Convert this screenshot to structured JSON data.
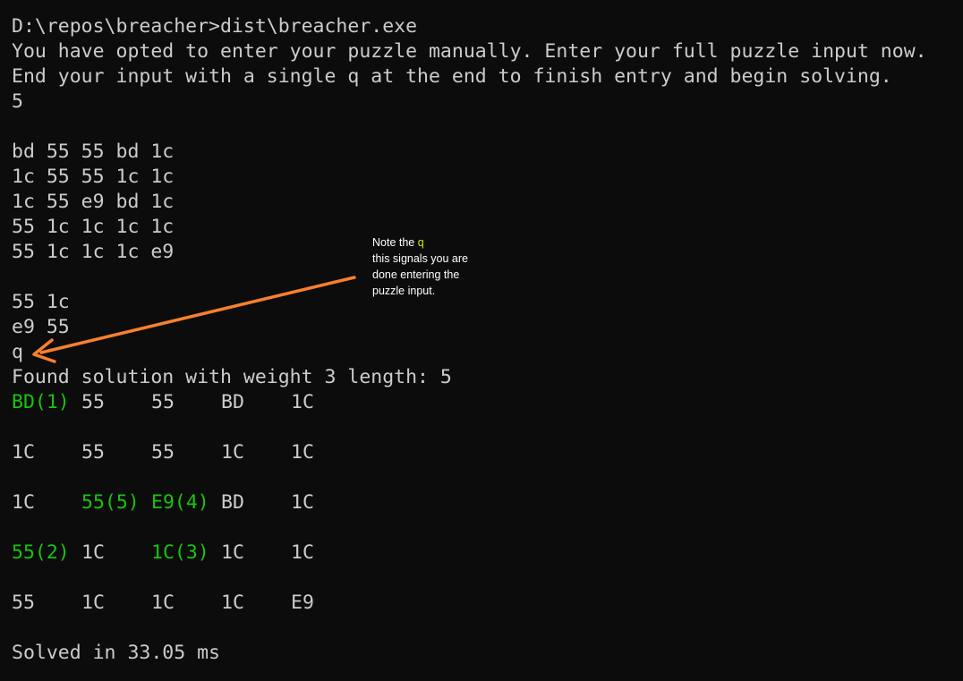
{
  "terminal": {
    "lines": [
      "D:\\repos\\breacher>dist\\breacher.exe",
      "You have opted to enter your puzzle manually. Enter your full puzzle input now.",
      "End your input with a single q at the end to finish entry and begin solving.",
      "5",
      "",
      "bd 55 55 bd 1c",
      "1c 55 55 1c 1c",
      "1c 55 e9 bd 1c",
      "55 1c 1c 1c 1c",
      "55 1c 1c 1c e9",
      "",
      "55 1c",
      "e9 55",
      "q",
      "Found solution with weight 3 length: 5"
    ],
    "solution_grid": [
      [
        {
          "t": "BD(1)",
          "hl": true
        },
        {
          "t": "55",
          "hl": false
        },
        {
          "t": "55",
          "hl": false
        },
        {
          "t": "BD",
          "hl": false
        },
        {
          "t": "1C",
          "hl": false
        }
      ],
      [
        {
          "t": "1C",
          "hl": false
        },
        {
          "t": "55",
          "hl": false
        },
        {
          "t": "55",
          "hl": false
        },
        {
          "t": "1C",
          "hl": false
        },
        {
          "t": "1C",
          "hl": false
        }
      ],
      [
        {
          "t": "1C",
          "hl": false
        },
        {
          "t": "55(5)",
          "hl": true
        },
        {
          "t": "E9(4)",
          "hl": true
        },
        {
          "t": "BD",
          "hl": false
        },
        {
          "t": "1C",
          "hl": false
        }
      ],
      [
        {
          "t": "55(2)",
          "hl": true
        },
        {
          "t": "1C",
          "hl": false
        },
        {
          "t": "1C(3)",
          "hl": true
        },
        {
          "t": "1C",
          "hl": false
        },
        {
          "t": "1C",
          "hl": false
        }
      ],
      [
        {
          "t": "55",
          "hl": false
        },
        {
          "t": "1C",
          "hl": false
        },
        {
          "t": "1C",
          "hl": false
        },
        {
          "t": "1C",
          "hl": false
        },
        {
          "t": "E9",
          "hl": false
        }
      ]
    ],
    "footer": "Solved in 33.05 ms"
  },
  "annotation": {
    "line1_prefix": "Note the ",
    "line1_q": "q",
    "line2": "this signals you are",
    "line3": "done entering the",
    "line4": "puzzle input."
  },
  "colors": {
    "background": "#0c0c0c",
    "text": "#cccccc",
    "highlight": "#16c60c",
    "arrow": "#f7802e",
    "note_q": "#c8e600"
  }
}
